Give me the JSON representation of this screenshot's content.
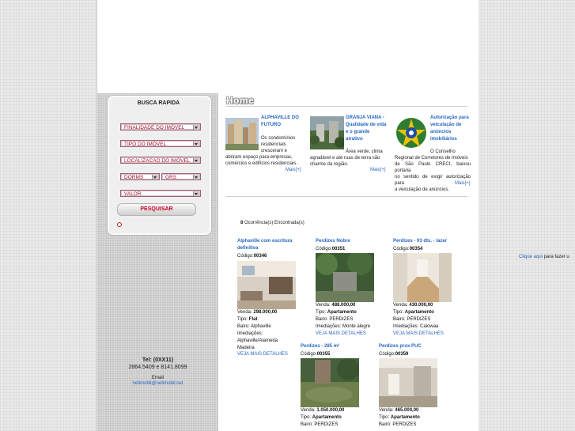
{
  "sidebar": {
    "search_title": "BUSCA RAPIDA",
    "fields": {
      "finalidade": "FINALIDADE DO IMÓVEL",
      "tipo": "TIPO DO IMÓVEL",
      "localizacao": "LOCALIZACAO DO IMÓVEL",
      "dorms": "DORMS",
      "grs": "GRS",
      "valor": "VALOR"
    },
    "search_button": "PESQUISAR",
    "contact": {
      "tel_label": "Tel: (0XX11)",
      "phones": "2864.5409 e 8141.8099",
      "email_label": "Email",
      "email": "netimobil@netimobil.net"
    }
  },
  "main": {
    "heading": "Home",
    "news": [
      {
        "title_lines": [
          "ALPHAVILLE DO",
          "FUTURO"
        ],
        "text_lines": [
          "Os condomínios",
          "residenciais",
          "cresceram e",
          "abriram espaço para empresas,",
          "comércios e edifícios residenciais."
        ],
        "more": "Mais[+]"
      },
      {
        "title_lines": [
          "GRANJA VIANA -",
          "Qualidade de vida",
          "e o grande",
          "atrativo"
        ],
        "text_lines": [
          "Área verde, clima",
          "agradável e até ruas de terra são",
          "charme da região."
        ],
        "more": "Mais[+]"
      },
      {
        "title_lines": [
          "Autorização para",
          "veiculação de",
          "anúncios",
          "imobiliários"
        ],
        "text_lines": [
          "O Conselho",
          "Regional de Corretores de Imóveis",
          "de São Paulo CRECI, baixou portaria",
          "no sentido de exigir autorização para",
          "a veiculação de anúncios."
        ],
        "more": "Mais[+]"
      }
    ],
    "results_count": "8",
    "results_label": " Ocorrência(s) Encontrada(s)",
    "properties": [
      {
        "title_lines": [
          "Alphaville com escritura",
          "definitiva"
        ],
        "code_label": "Código:",
        "code": "00346",
        "lines": [
          {
            "label": "Venda: ",
            "value": "298.000,00"
          },
          {
            "label": "Tipo: ",
            "value": "Flat"
          },
          {
            "label": "Bairo: ",
            "value": "Alphaville"
          },
          {
            "label": "Imediações:",
            "value": ""
          },
          {
            "label": "Alphaville/Alameda",
            "value": ""
          },
          {
            "label": "Madeira",
            "value": ""
          }
        ],
        "link": "VEJA MAIS DETALHES"
      },
      {
        "title_lines": [
          "Perdizes Nobre"
        ],
        "code_label": "Código:",
        "code": "00351",
        "lines": [
          {
            "label": "Venda: ",
            "value": "488.000,00"
          },
          {
            "label": "Tipo: ",
            "value": "Apartamento"
          },
          {
            "label": "Bairo: ",
            "value": "PERDIZES"
          },
          {
            "label": "Imediações: ",
            "value": "Monte alegre"
          }
        ],
        "link": "VEJA MAIS DETALHES"
      },
      {
        "title_lines": [
          "Perdizes - 03 dts. - lazer"
        ],
        "code_label": "Código:",
        "code": "00354",
        "lines": [
          {
            "label": "Venda: ",
            "value": "430.000,00"
          },
          {
            "label": "Tipo: ",
            "value": "Apartamento"
          },
          {
            "label": "Bairo: ",
            "value": "PERDIZES"
          },
          {
            "label": "Imediações: ",
            "value": "Caiowaa"
          }
        ],
        "link": "VEJA MAIS DETALHES"
      },
      {
        "title_lines": [
          "Perdizes - 285 m²"
        ],
        "code_label": "Código:",
        "code": "00355",
        "lines": [
          {
            "label": "Venda: ",
            "value": "1.050.000,00"
          },
          {
            "label": "Tipo: ",
            "value": "Apartamento"
          },
          {
            "label": "Bairo: ",
            "value": "PERDIZES"
          }
        ],
        "link": ""
      },
      {
        "title_lines": [
          "Perdizes prox PUC"
        ],
        "code_label": "Código:",
        "code": "00359",
        "lines": [
          {
            "label": "Venda: ",
            "value": "465.000,00"
          },
          {
            "label": "Tipo: ",
            "value": "Apartamento"
          },
          {
            "label": "Bairo: ",
            "value": "PERDIZES"
          }
        ],
        "link": ""
      }
    ]
  },
  "right_side": {
    "link": "Clique aqui",
    "text": " para fazer u"
  }
}
